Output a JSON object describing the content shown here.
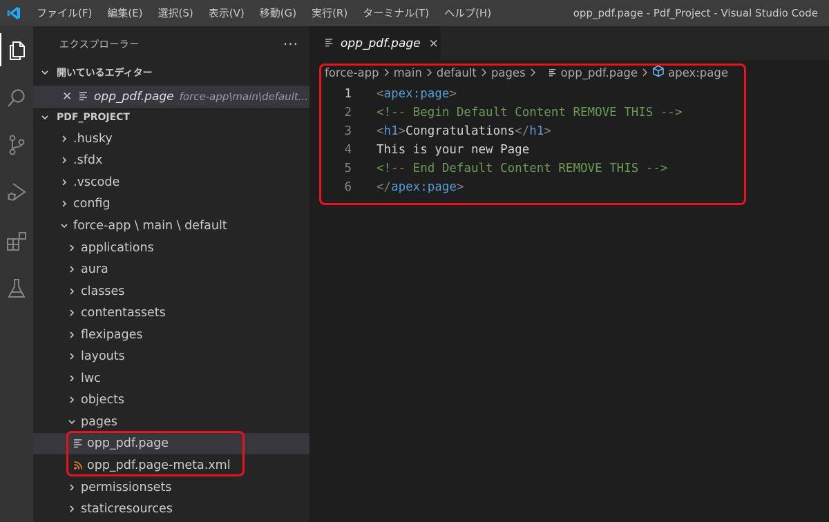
{
  "menu": [
    "ファイル(F)",
    "編集(E)",
    "選択(S)",
    "表示(V)",
    "移動(G)",
    "実行(R)",
    "ターミナル(T)",
    "ヘルプ(H)"
  ],
  "window_title": "opp_pdf.page - Pdf_Project - Visual Studio Code",
  "activity_icons": [
    "explorer-icon",
    "search-icon",
    "source-control-icon",
    "run-debug-icon",
    "extensions-icon",
    "testing-icon"
  ],
  "sidebar": {
    "title": "エクスプローラー",
    "more": "···",
    "open_editors": {
      "label": "開いているエディター",
      "file": "opp_pdf.page",
      "path": "force-app\\main\\default..."
    },
    "project": {
      "label": "PDF_PROJECT",
      "items": [
        {
          "label": ".husky",
          "open": false
        },
        {
          "label": ".sfdx",
          "open": false
        },
        {
          "label": ".vscode",
          "open": false
        },
        {
          "label": "config",
          "open": false
        },
        {
          "label": "force-app \\ main \\ default",
          "open": true
        },
        {
          "label": "applications",
          "open": false
        },
        {
          "label": "aura",
          "open": false
        },
        {
          "label": "classes",
          "open": false
        },
        {
          "label": "contentassets",
          "open": false
        },
        {
          "label": "flexipages",
          "open": false
        },
        {
          "label": "layouts",
          "open": false
        },
        {
          "label": "lwc",
          "open": false
        },
        {
          "label": "objects",
          "open": false
        },
        {
          "label": "pages",
          "open": true
        },
        {
          "label": "opp_pdf.page",
          "type": "file"
        },
        {
          "label": "opp_pdf.page-meta.xml",
          "type": "xml"
        },
        {
          "label": "permissionsets",
          "open": false
        },
        {
          "label": "staticresources",
          "open": false
        }
      ]
    }
  },
  "editor": {
    "tab": {
      "label": "opp_pdf.page",
      "close": "×"
    },
    "breadcrumb": [
      "force-app",
      "main",
      "default",
      "pages",
      "opp_pdf.page",
      "apex:page"
    ],
    "lines": [
      {
        "n": "1",
        "open": "<",
        "tag": "apex:page",
        "close": ">"
      },
      {
        "n": "2",
        "comment": "<!-- Begin Default Content REMOVE THIS -->"
      },
      {
        "n": "3",
        "o1": "<",
        "t1": "h1",
        "c1": ">",
        "text": "Congratulations",
        "o2": "</",
        "t2": "h1",
        "c2": ">"
      },
      {
        "n": "4",
        "text": "This is your new Page"
      },
      {
        "n": "5",
        "comment": "<!-- End Default Content REMOVE THIS -->"
      },
      {
        "n": "6",
        "open": "</",
        "tag": "apex:page",
        "close": ">"
      }
    ]
  },
  "colors": {
    "highlight_box": "#e8141d",
    "tag": "#569cd6",
    "comment": "#6a9955",
    "xml_icon": "#e37933"
  }
}
